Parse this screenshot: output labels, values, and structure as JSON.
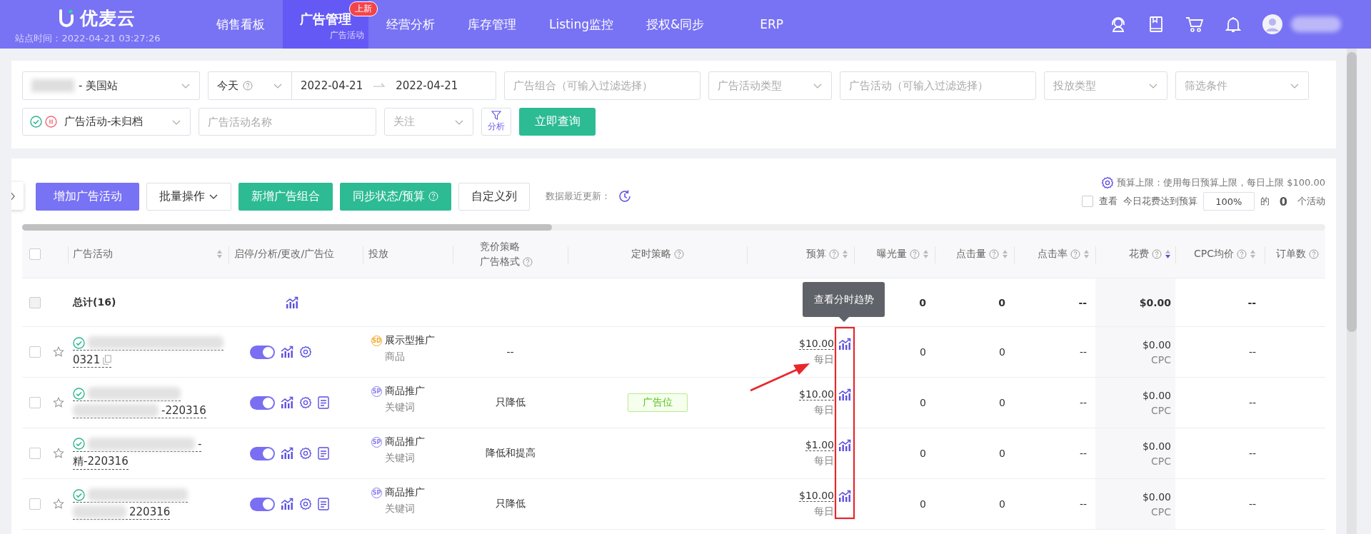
{
  "header": {
    "logo": "优麦云",
    "site_time": "站点时间：2022-04-21 03:27:26",
    "nav": [
      {
        "label": "销售看板",
        "selected": false
      },
      {
        "label": "广告管理",
        "selected": true,
        "sublabel": "广告活动",
        "badge": "上新"
      },
      {
        "label": "经营分析",
        "selected": false
      },
      {
        "label": "库存管理",
        "selected": false
      },
      {
        "label": "Listing监控",
        "selected": false
      },
      {
        "label": "授权&同步",
        "selected": false
      },
      {
        "label": "ERP",
        "selected": false
      }
    ]
  },
  "filter_rows": [
    [
      {
        "kind": "shop",
        "value": "- 美国站"
      },
      {
        "kind": "date_range",
        "preset": "今天",
        "start": "2022-04-21",
        "end": "2022-04-21"
      },
      {
        "kind": "input",
        "placeholder": "广告组合（可输入过滤选择）"
      },
      {
        "kind": "select",
        "placeholder": "广告活动类型"
      },
      {
        "kind": "input",
        "placeholder": "广告活动（可输入过滤选择）"
      },
      {
        "kind": "select",
        "placeholder": "投放类型"
      },
      {
        "kind": "select",
        "placeholder": "筛选条件"
      }
    ],
    [
      {
        "kind": "status",
        "value": "广告活动-未归档"
      },
      {
        "kind": "input",
        "placeholder": "广告活动名称"
      },
      {
        "kind": "select",
        "placeholder": "关注"
      },
      {
        "kind": "analysis",
        "label": "分析"
      },
      {
        "kind": "submit",
        "label": "立即查询"
      }
    ]
  ],
  "toolbar": {
    "buttons": [
      {
        "kind": "primary",
        "label": "增加广告活动"
      },
      {
        "kind": "default",
        "label": "批量操作",
        "caret": true
      },
      {
        "kind": "teal",
        "label": "新增广告组合"
      },
      {
        "kind": "teal",
        "label": "同步状态/预算",
        "help": true
      },
      {
        "kind": "default",
        "label": "自定义列"
      }
    ],
    "update_label": "数据最近更新：",
    "budget_note": "预算上限：使用每日预算上限，每日上限 $100.00",
    "spend_filter": {
      "checked": false,
      "label": "查看",
      "text": "今日花费达到预算",
      "value": "100%",
      "suffix": "的",
      "count": "0",
      "unit": "个活动"
    }
  },
  "table": {
    "select_all_checked": false,
    "columns": [
      {
        "label": "广告活动",
        "sortable": true
      },
      {
        "label": "启停/分析/更改/广告位"
      },
      {
        "label": "投放"
      },
      {
        "label": "竞价策略",
        "label2": "广告格式",
        "help": true
      },
      {
        "label": "定时策略",
        "help": true
      },
      {
        "label": "预算",
        "help": true,
        "sortable": true
      },
      {
        "label": "曝光量",
        "help": true,
        "sortable": true
      },
      {
        "label": "点击量",
        "help": true,
        "sortable": true
      },
      {
        "label": "点击率",
        "help": true,
        "sortable": true
      },
      {
        "label": "花费",
        "help": true,
        "sortable": true,
        "sorted_desc": true
      },
      {
        "label": "CPC均价",
        "help": true,
        "sortable": true
      },
      {
        "label": "订单数",
        "help": true
      }
    ],
    "total": {
      "checked": false,
      "label": "总计(16)",
      "impressions": "0",
      "clicks": "0",
      "ctr": "--",
      "spend": "$0.00",
      "cpc": "--"
    },
    "rows": [
      {
        "checked": false,
        "starred": false,
        "status_enabled": true,
        "name_lines": [
          {
            "blurred": true
          },
          {
            "blurred": false,
            "text": "0321",
            "copy": true
          }
        ],
        "enabled": true,
        "has_doc": false,
        "ad_code": "SD",
        "ad_type": "展示型推广",
        "ad_sub": "商品",
        "bid": "--",
        "budget": "$10.00",
        "period": "每日",
        "impressions": "0",
        "clicks": "0",
        "ctr": "--",
        "spend": "$0.00",
        "spend_unit": "CPC",
        "cpc": "--"
      },
      {
        "checked": false,
        "starred": false,
        "status_enabled": true,
        "name_lines": [
          {
            "blurred": true
          },
          {
            "blurred": true,
            "text": "-220316"
          }
        ],
        "enabled": true,
        "has_doc": true,
        "ad_code": "SP",
        "ad_type": "商品推广",
        "ad_sub": "关键词",
        "bid": "只降低",
        "schedule_tag": "广告位",
        "budget": "$10.00",
        "period": "每日",
        "impressions": "0",
        "clicks": "0",
        "ctr": "--",
        "spend": "$0.00",
        "spend_unit": "CPC",
        "cpc": "--"
      },
      {
        "checked": false,
        "starred": false,
        "status_enabled": true,
        "name_lines": [
          {
            "blurred": true,
            "text": "-"
          },
          {
            "blurred": false,
            "text": "精-220316"
          }
        ],
        "enabled": true,
        "has_doc": true,
        "ad_code": "SP",
        "ad_type": "商品推广",
        "ad_sub": "关键词",
        "bid": "降低和提高",
        "budget": "$1.00",
        "period": "每日",
        "impressions": "0",
        "clicks": "0",
        "ctr": "--",
        "spend": "$0.00",
        "spend_unit": "CPC",
        "cpc": "--"
      },
      {
        "checked": false,
        "starred": false,
        "status_enabled": true,
        "name_lines": [
          {
            "blurred": true
          },
          {
            "blurred": true,
            "text": "220316"
          }
        ],
        "enabled": true,
        "has_doc": true,
        "ad_code": "SP",
        "ad_type": "商品推广",
        "ad_sub": "关键词",
        "bid": "只降低",
        "budget": "$10.00",
        "period": "每日",
        "impressions": "0",
        "clicks": "0",
        "ctr": "--",
        "spend": "$0.00",
        "spend_unit": "CPC",
        "cpc": "--"
      }
    ]
  },
  "tooltip": {
    "text": "查看分时趋势"
  },
  "annotation": {
    "kind": "highlight_arrow"
  }
}
